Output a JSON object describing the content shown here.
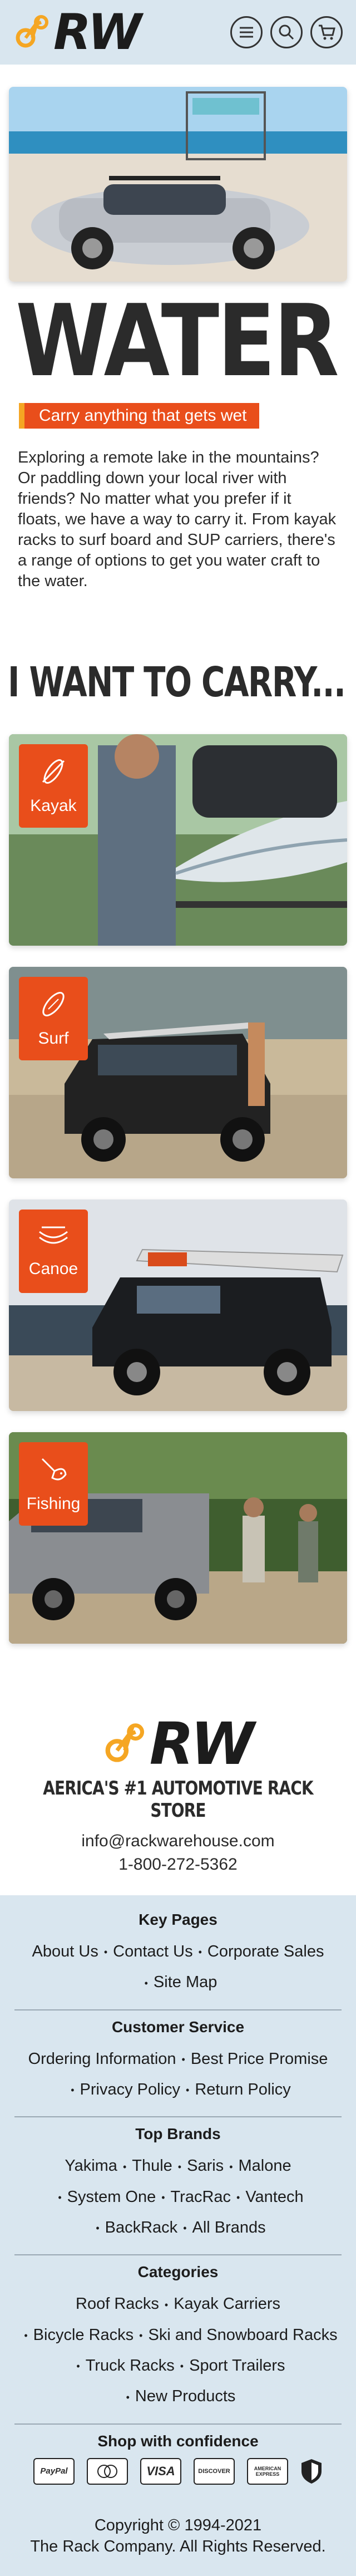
{
  "header": {
    "logo_text": "RW",
    "icons": [
      "menu-icon",
      "search-icon",
      "cart-icon"
    ]
  },
  "hero": {
    "title": "WATER",
    "tagline": "Carry anything that gets wet",
    "intro": "Exploring a remote lake in the mountains? Or paddling down your local river with friends? No matter what you prefer if it floats, we have a way to carry it. From kayak racks to surf board and SUP carriers, there's a range of options to get you water craft to the water."
  },
  "carry": {
    "title": "I WANT TO CARRY...",
    "items": [
      {
        "label": "Kayak",
        "icon": "kayak-icon"
      },
      {
        "label": "Surf",
        "icon": "surfboard-icon"
      },
      {
        "label": "Canoe",
        "icon": "canoe-icon"
      },
      {
        "label": "Fishing",
        "icon": "fishing-icon"
      }
    ]
  },
  "store": {
    "logo_text": "RW",
    "name": "AERICA'S #1 AUTOMOTIVE RACK STORE",
    "email": "info@rackwarehouse.com",
    "phone": "1-800-272-5362"
  },
  "footer": {
    "key_pages": {
      "title": "Key Pages",
      "links": [
        "About Us",
        "Contact Us",
        "Corporate Sales",
        "Site Map"
      ]
    },
    "customer_service": {
      "title": "Customer Service",
      "links": [
        "Ordering Information",
        "Best Price Promise",
        "Privacy Policy",
        "Return Policy"
      ]
    },
    "top_brands": {
      "title": "Top Brands",
      "links": [
        "Yakima",
        "Thule",
        "Saris",
        "Malone",
        "System One",
        "TracRac",
        "Vantech",
        "BackRack",
        "All Brands"
      ]
    },
    "categories": {
      "title": "Categories",
      "links": [
        "Roof Racks",
        "Kayak Carriers",
        "Bicycle Racks",
        "Ski and Snowboard Racks",
        "Truck Racks",
        "Sport Trailers",
        "New Products"
      ]
    },
    "confidence": {
      "title": "Shop with confidence",
      "cards": [
        "PayPal",
        "MasterCard",
        "VISA",
        "DISCOVER",
        "AMERICAN EXPRESS"
      ]
    },
    "copyright_line1": "Copyright © 1994-2021",
    "copyright_line2": "The Rack Company. All Rights Reserved."
  },
  "colors": {
    "accent": "#e94e1b",
    "accent_yellow": "#f5a623",
    "header_bg": "#d9e6ef",
    "text": "#2b2b2b"
  }
}
